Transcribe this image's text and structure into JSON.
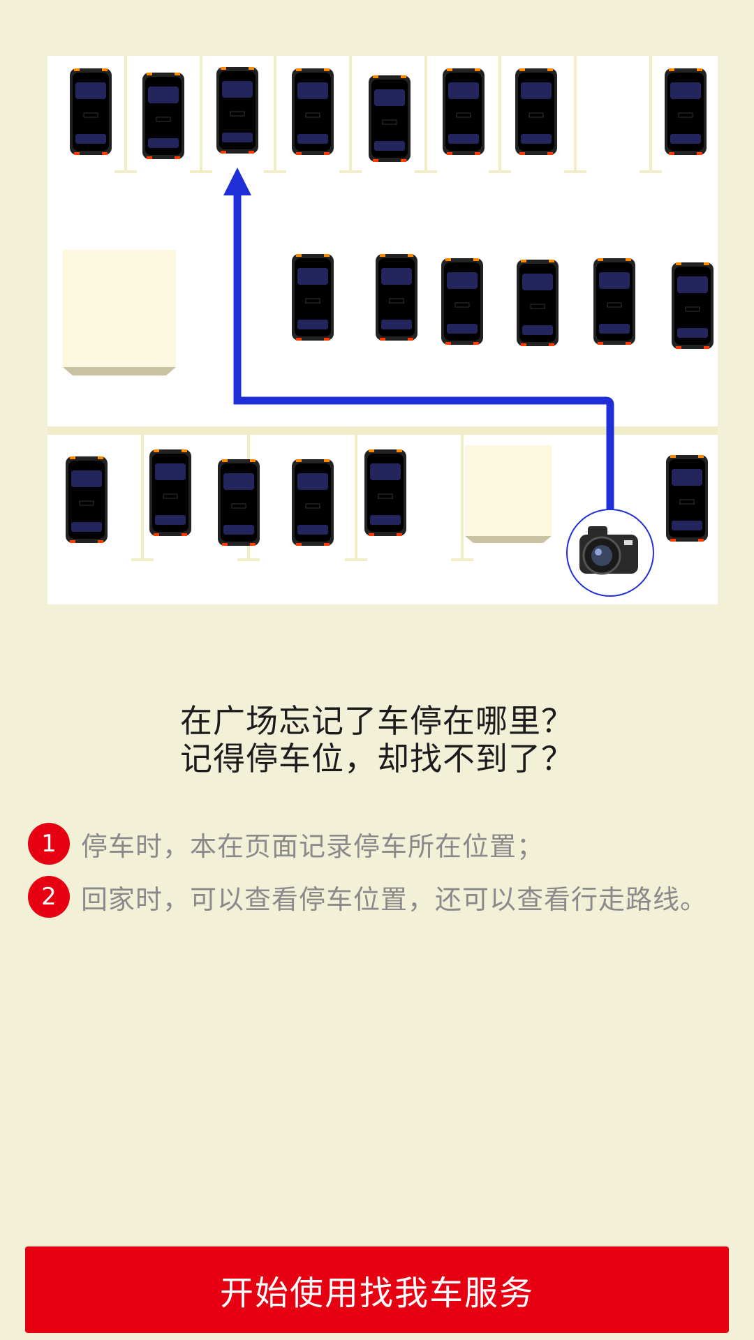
{
  "illustration": {
    "icon": "parking-lot-map",
    "camera_icon": "camera-icon",
    "route_color": "#1f2fd8"
  },
  "headline": {
    "line1": "在广场忘记了车停在哪里？",
    "line2": "记得停车位，却找不到了？"
  },
  "steps": [
    {
      "number": "1",
      "text": "停车时，本在页面记录停车所在位置；"
    },
    {
      "number": "2",
      "text": "回家时，可以查看停车位置，还可以查看行走路线。"
    }
  ],
  "cta": {
    "label": "开始使用找我车服务"
  },
  "colors": {
    "background": "#f3f0d8",
    "accent": "#e60012",
    "lane_line": "#f1edc9",
    "block_fill": "#fbf8df"
  }
}
